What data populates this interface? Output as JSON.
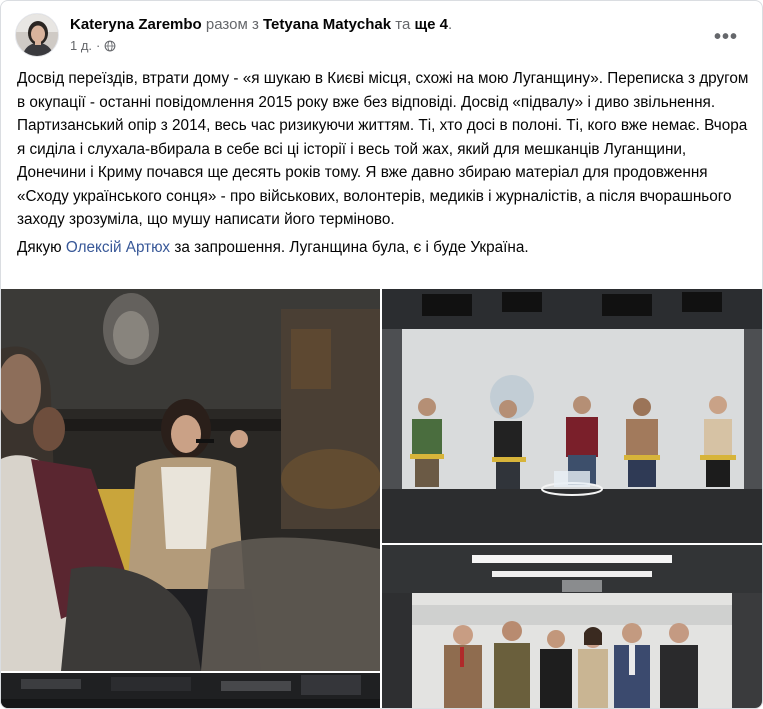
{
  "post": {
    "author": "Kateryna Zarembo",
    "with_text": "разом з",
    "coauthor": "Tetyana Matychak",
    "and_text": "та",
    "others": "ще 4",
    "period": ".",
    "time": "1 д.",
    "dot": "·",
    "paragraph1": "Досвід переїздів, втрати дому - «я шукаю в Києві місця, схожі на мою Луганщину». Переписка з другом в окупації - останні повідомлення 2015 року вже без відповіді. Досвід «підвалу» і диво звільнення. Партизанський опір з 2014, весь час ризикуючи життям. Ті, хто досі в полоні. Ті, кого вже немає. Вчора я сиділа і слухала-вбирала в себе всі ці історії і весь той жах, який для мешканців Луганщини, Донечини і Криму почався ще десять років тому. Я вже давно збираю матеріал для продовження «Сходу українського сонця» - про військових, волонтерів, медиків і журналістів, а після вчорашнього заходу зрозуміла, що мушу написати його терміново.",
    "p2_before": "Дякую",
    "p2_tag": "Олексій Артюх",
    "p2_after": "за запрошення. Луганщина була, є і буде Україна."
  },
  "icons": {
    "more": "more-options-icon",
    "privacy": "globe-icon"
  },
  "colors": {
    "link": "#385898",
    "secondary_text": "#65676b",
    "background": "#ffffff"
  }
}
